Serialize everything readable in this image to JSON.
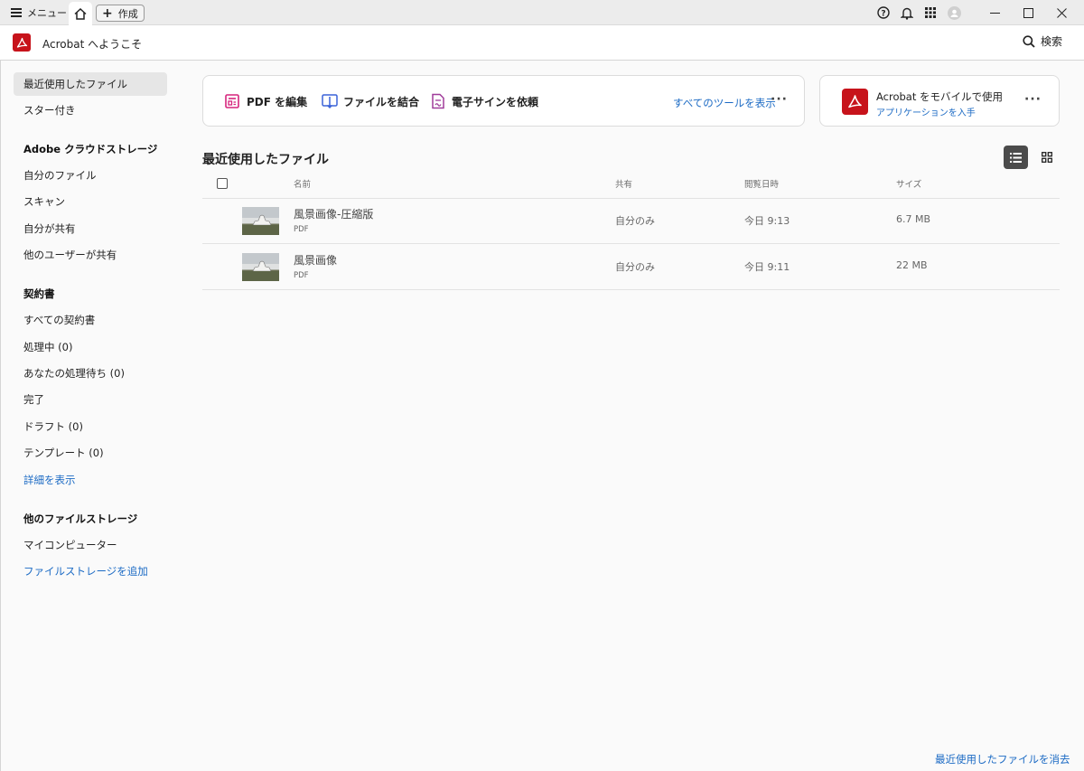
{
  "titlebar": {
    "menu_label": "メニュー",
    "create_label": "作成",
    "icons": [
      "help-icon",
      "bell-icon",
      "apps-grid-icon",
      "avatar"
    ],
    "window_controls": [
      "minimize",
      "maximize",
      "close"
    ]
  },
  "header": {
    "title": "Acrobat へようこそ",
    "search_label": "検索"
  },
  "sidebar": {
    "recent": "最近使用したファイル",
    "starred": "スター付き",
    "cloud_heading": "Adobe クラウドストレージ",
    "cloud_items": [
      "自分のファイル",
      "スキャン",
      "自分が共有",
      "他のユーザーが共有"
    ],
    "contracts_heading": "契約書",
    "contract_items": [
      "すべての契約書",
      "処理中 (0)",
      "あなたの処理待ち (0)",
      "完了",
      "ドラフト (0)",
      "テンプレート (0)"
    ],
    "show_more": "詳細を表示",
    "other_heading": "他のファイルストレージ",
    "other_items": [
      "マイコンピューター"
    ],
    "add_storage": "ファイルストレージを追加"
  },
  "tools": {
    "items": [
      "PDF を編集",
      "ファイルを結合",
      "電子サインを依頼"
    ],
    "see_all": "すべてのツールを表示",
    "colors": {
      "edit": "#d6247c",
      "combine": "#3b63d8",
      "sign": "#a03c9a"
    }
  },
  "mobile": {
    "title": "Acrobat をモバイルで使用",
    "link": "アプリケーションを入手"
  },
  "recent": {
    "title": "最近使用したファイル",
    "columns": {
      "name": "名前",
      "shared": "共有",
      "viewed": "閲覧日時",
      "size": "サイズ"
    },
    "rows": [
      {
        "name": "風景画像-圧縮版",
        "type": "PDF",
        "shared": "自分のみ",
        "viewed": "今日 9:13",
        "size": "6.7 MB"
      },
      {
        "name": "風景画像",
        "type": "PDF",
        "shared": "自分のみ",
        "viewed": "今日 9:11",
        "size": "22 MB"
      }
    ],
    "clear_label": "最近使用したファイルを消去"
  },
  "colors": {
    "brand_red": "#c7131b",
    "link_blue": "#1b6ac4"
  }
}
